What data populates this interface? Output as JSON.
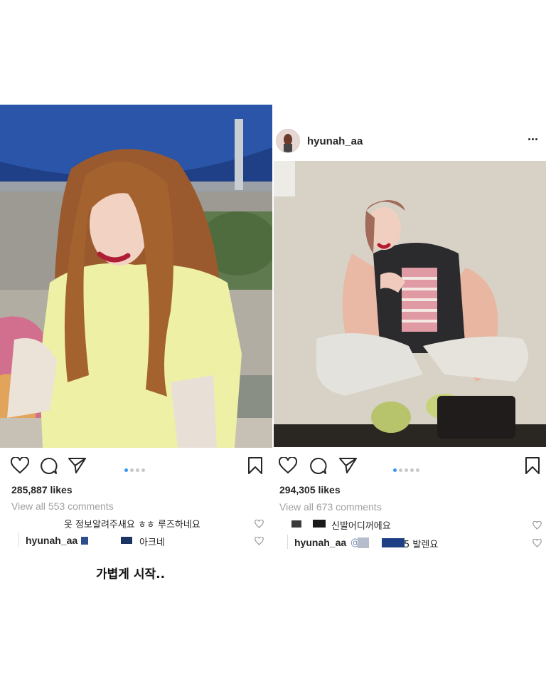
{
  "left_post": {
    "likes": "285,887 likes",
    "view_all": "View all 553 comments",
    "comment1_text": "옷 정보알려주새요 ㅎㅎ 루즈하네요",
    "reply_user": "hyunah_aa",
    "reply_text": "아크네",
    "caption": "가볍게 시작..",
    "carousel_count": 4,
    "carousel_active": 0
  },
  "right_post": {
    "header_username": "hyunah_aa",
    "more_label": "···",
    "likes": "294,305 likes",
    "view_all": "View all 673 comments",
    "comment1_text": "신발어디꺼에요",
    "reply_user": "hyunah_aa",
    "reply_mention": "@",
    "reply_text": "5 발렌요",
    "carousel_count": 5,
    "carousel_active": 0
  },
  "icons": {
    "like": "heart-icon",
    "comment": "comment-bubble-icon",
    "share": "paper-plane-icon",
    "save": "bookmark-icon",
    "small_like": "small-heart-icon"
  },
  "colors": {
    "carousel_active": "#3897f0",
    "carousel_inactive": "#c8c8c8",
    "text": "#262626",
    "muted": "#a0a0a0"
  }
}
